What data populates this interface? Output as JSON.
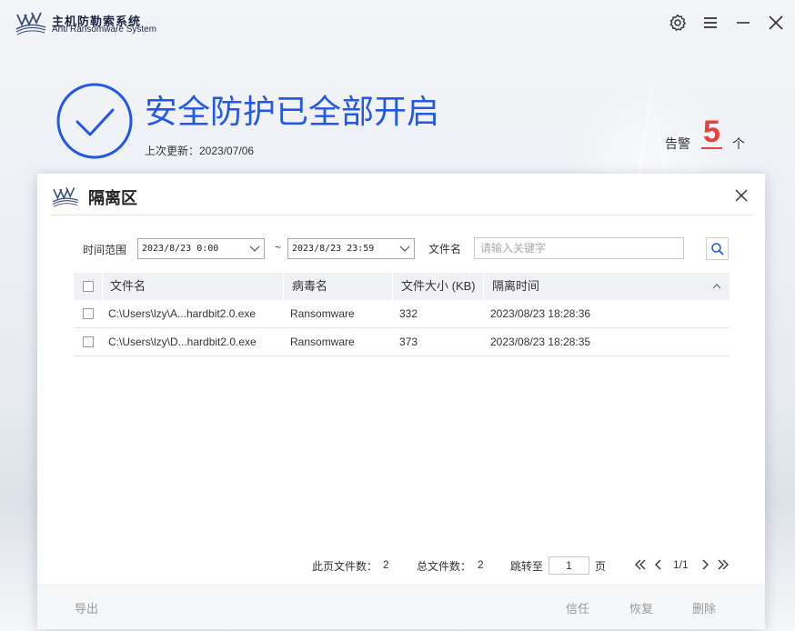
{
  "app": {
    "title": "主机防勒索系统",
    "subtitle": "Anti Ransomware System"
  },
  "titlebar": {
    "icons": [
      "gear-icon",
      "menu-icon",
      "minimize-icon",
      "close-icon"
    ]
  },
  "status": {
    "title": "安全防护已全部开启",
    "last_update": "上次更新：2023/07/06",
    "alert_label": "告警",
    "alert_count": "5",
    "alert_unit": "个"
  },
  "dialog": {
    "title": "隔离区",
    "filters": {
      "time_range_label": "时间范围",
      "start_time": "2023/8/23 0:00",
      "separator": "~",
      "end_time": "2023/8/23 23:59",
      "filename_label": "文件名",
      "search_placeholder": "请输入关键字"
    },
    "table": {
      "columns": [
        "文件名",
        "病毒名",
        "文件大小 (KB)",
        "隔离时间"
      ],
      "rows": [
        {
          "file": "C:\\Users\\lzy\\A...hardbit2.0.exe",
          "virus": "Ransomware",
          "size": "332",
          "time": "2023/08/23 18:28:36"
        },
        {
          "file": "C:\\Users\\lzy\\D...hardbit2.0.exe",
          "virus": "Ransomware",
          "size": "373",
          "time": "2023/08/23 18:28:35"
        }
      ]
    },
    "pagination": {
      "page_files_label": "此页文件数：",
      "page_files": "2",
      "total_files_label": "总文件数：",
      "total_files": "2",
      "jump_label": "跳转至",
      "jump_value": "1",
      "page_unit": "页",
      "page_indicator": "1/1"
    },
    "actions": {
      "export": "导出",
      "trust": "信任",
      "restore": "恢复",
      "delete": "删除"
    }
  },
  "colors": {
    "accent": "#2358e6",
    "alert": "#e8403c",
    "disabled_text": "#9a9a9a"
  }
}
